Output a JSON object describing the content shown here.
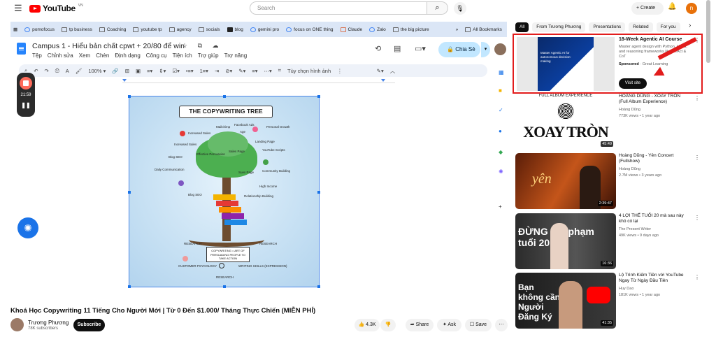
{
  "header": {
    "logo_text": "YouTube",
    "logo_sup": "VN",
    "search_placeholder": "Search",
    "create_label": "Create",
    "avatar_letter": "n"
  },
  "bookmarks": [
    "pomofocus",
    "tp business",
    "Coaching",
    "youtube tp",
    "agency",
    "socials",
    "blog",
    "gemini pro",
    "focus on ONE thing",
    "Claude",
    "Zalo",
    "the big picture"
  ],
  "bookmarks_all": "All Bookmarks",
  "docs": {
    "title": "Campus 1 - Hiểu bản chất cpwt + 20/80 để win",
    "menu": [
      "Tệp",
      "Chỉnh sửa",
      "Xem",
      "Chèn",
      "Định dạng",
      "Công cụ",
      "Tiện ích",
      "Trợ giúp",
      "Trợ năng"
    ],
    "share_label": "Chia Sẻ",
    "zoom": "100%",
    "image_options": "Tùy chọn hình ảnh"
  },
  "recorder": {
    "time": "21:59"
  },
  "image": {
    "title": "THE COPYWRITING TREE",
    "labels": [
      "Mailchimp",
      "Facebook Ads",
      "Personal Growth",
      "Increased Sales",
      "Age",
      "Landing Page",
      "Increased Sales",
      "Effective Persuasion",
      "Sales Page",
      "YouTube Scripts",
      "Blog SEO",
      "Daily Communication",
      "Sues Page",
      "Community Building",
      "High Income",
      "Blog SEO",
      "Relationship Building",
      "RESEARCH",
      "RESEARCH",
      "CUSTOMER PSYCOLOGY",
      "WRITING SKILLS (EXPRESSION)",
      "RESEARCH"
    ],
    "center_text": "COPYWRITING = ART OF PERSUADING PEOPLE TO TAKE ACTION"
  },
  "video": {
    "title": "Khoá Học Copywriting 11 Tiếng Cho Người Mới | Từ 0 Đến $1.000/ Tháng Thực Chiến (MIỄN PHÍ)",
    "channel": "Trương Phương",
    "subs": "78K subscribers",
    "subscribe": "Subscribe",
    "likes": "4.3K",
    "share": "Share",
    "ask": "Ask",
    "save": "Save"
  },
  "chips": [
    "All",
    "From Trương Phương",
    "Presentations",
    "Related",
    "For you"
  ],
  "ad": {
    "title": "18-Week Agentic AI Course",
    "desc": "Master agent design with Python, LLMs, and reasoning frameworks like ReAct & CoT",
    "sponsored": "Sponsored",
    "advertiser": "Great Learning",
    "visit": "Visit site",
    "thumb_text": "Master Agentic AI for autonomous decision-making"
  },
  "related": [
    {
      "title": "HOÀNG DŨNG - XOAY TRÒN (Full Album Experience)",
      "channel": "Hoàng Dũng",
      "meta": "773K views • 1 year ago",
      "duration": "45:49",
      "thumb_text": "XOAY TRÒN",
      "thumb_caption": "FULL ALBUM EXPERIENCE"
    },
    {
      "title": "Hoàng Dũng - Yên Concert (Fullshow)",
      "channel": "Hoàng Dũng",
      "meta": "2.7M views • 3 years ago",
      "duration": "2:39:47",
      "thumb_text": "yên"
    },
    {
      "title": "4 LỢI THẾ TUỔI 20 mà sau này khó có lại",
      "channel": "The Present Writer",
      "meta": "49K views • 9 days ago",
      "duration": "16:36",
      "thumb_text": "ĐỪNG phí phạm tuổi 20"
    },
    {
      "title": "Lộ Trình Kiếm Tiền với YouTube Ngay Từ Ngày Đầu Tiên",
      "channel": "Huy Dao",
      "meta": "181K views • 1 year ago",
      "duration": "41:35",
      "thumb_text": "Bạn không cần Người Đăng Ký"
    }
  ]
}
